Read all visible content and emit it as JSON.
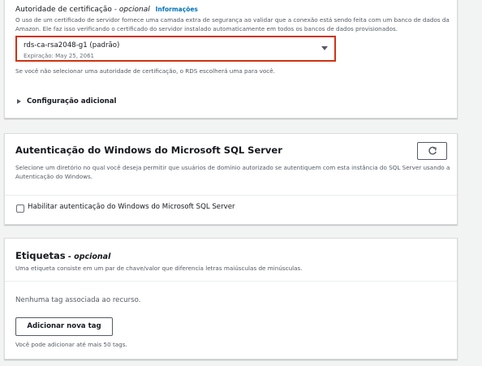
{
  "certificate": {
    "label": "Autoridade de certificação",
    "label_optional": " - opcional",
    "info_link": "Informações",
    "description": "O uso de um certificado de servidor fornece uma camada extra de segurança ao validar que a conexão está sendo feita com um banco de dados da Amazon. Ele faz isso verificando o certificado do servidor instalado automaticamente em todos os bancos de dados provisionados.",
    "selected_value": "rds-ca-rsa2048-g1 (padrão)",
    "selected_sub": "Expiração: May 25, 2061",
    "hint": "Se você não selecionar uma autoridade de certificação, o RDS escolherá uma para você.",
    "caret_icon": "caret-down-icon",
    "highlight_color": "#d13212"
  },
  "additional_config": {
    "label": "Configuração adicional",
    "icon": "caret-right-icon"
  },
  "windows_auth": {
    "title": "Autenticação do Windows do Microsoft SQL Server",
    "description": "Selecione um diretório no qual você deseja permitir que usuários de domínio autorizado se autentiquem com esta instância do SQL Server usando a Autenticação do Windows.",
    "refresh_icon": "refresh-icon",
    "checkbox_label": "Habilitar autenticação do Windows do Microsoft SQL Server",
    "checkbox_checked": false
  },
  "tags": {
    "title": "Etiquetas",
    "title_optional": " - opcional",
    "description": "Uma etiqueta consiste em um par de chave/valor que diferencia letras maiúsculas de minúsculas.",
    "empty_text": "Nenhuma tag associada ao recurso.",
    "add_button": "Adicionar nova tag",
    "limit_note": "Você pode adicionar até mais 50 tags."
  }
}
